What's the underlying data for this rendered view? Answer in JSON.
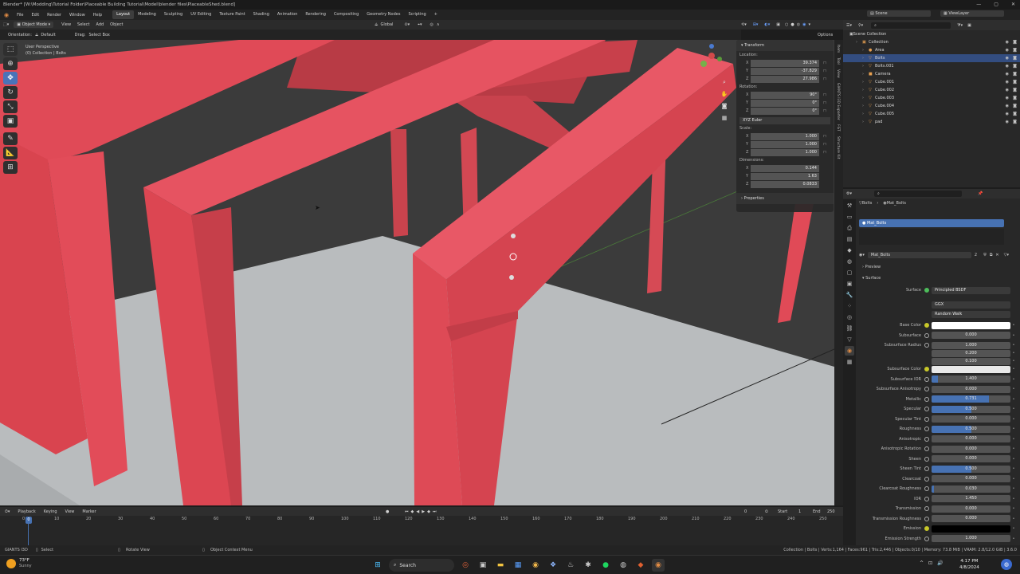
{
  "titlebar": {
    "title": "Blender* [W:\\Modding\\Tutorial Folder\\Placeable Building Tutorial\\Model\\blender files\\PlaceableShed.blend]",
    "minimize": "—",
    "maximize": "▢",
    "close": "✕"
  },
  "menu": {
    "items": [
      "File",
      "Edit",
      "Render",
      "Window",
      "Help"
    ]
  },
  "workspaces": [
    "Layout",
    "Modeling",
    "Sculpting",
    "UV Editing",
    "Texture Paint",
    "Shading",
    "Animation",
    "Rendering",
    "Compositing",
    "Geometry Nodes",
    "Scripting",
    "+"
  ],
  "scene": {
    "scene_label": "Scene",
    "viewlayer_label": "ViewLayer"
  },
  "viewport_header": {
    "mode": "Object Mode",
    "menus": [
      "View",
      "Select",
      "Add",
      "Object"
    ],
    "orientation_label": "Orientation:",
    "orientation": "Default",
    "drag_label": "Drag:",
    "drag": "Select Box",
    "transform": "Global",
    "options": "Options"
  },
  "viewport": {
    "perspective": "User Perspective",
    "collection": "(0) Collection | Bolts"
  },
  "npanel": {
    "transform_title": "Transform",
    "location_label": "Location:",
    "location": [
      {
        "axis": "X",
        "value": "39.374"
      },
      {
        "axis": "Y",
        "value": "-37.829"
      },
      {
        "axis": "Z",
        "value": "27.986"
      }
    ],
    "rotation_label": "Rotation:",
    "rotation": [
      {
        "axis": "X",
        "value": "90°"
      },
      {
        "axis": "Y",
        "value": "0°"
      },
      {
        "axis": "Z",
        "value": "0°"
      }
    ],
    "rotation_mode": "XYZ Euler",
    "scale_label": "Scale:",
    "scale": [
      {
        "axis": "X",
        "value": "1.000"
      },
      {
        "axis": "Y",
        "value": "1.000"
      },
      {
        "axis": "Z",
        "value": "1.000"
      }
    ],
    "dimensions_label": "Dimensions:",
    "dimensions": [
      {
        "axis": "X",
        "value": "0.144"
      },
      {
        "axis": "Y",
        "value": "1.63"
      },
      {
        "axis": "Z",
        "value": "0.0833"
      }
    ],
    "properties_title": "Properties",
    "tabs": [
      "Item",
      "Tool",
      "View",
      "GIANTS I3D Exporter",
      "FGT",
      "Structure Kit"
    ]
  },
  "outliner": {
    "root": "Scene Collection",
    "rows": [
      {
        "name": "Collection",
        "indent": 1,
        "icon": "▣"
      },
      {
        "name": "Area",
        "indent": 2,
        "icon": "●"
      },
      {
        "name": "Bolts",
        "indent": 2,
        "icon": "▽",
        "selected": true
      },
      {
        "name": "Bolts.001",
        "indent": 2,
        "icon": "▽"
      },
      {
        "name": "Camera",
        "indent": 2,
        "icon": "■"
      },
      {
        "name": "Cube.001",
        "indent": 2,
        "icon": "▽"
      },
      {
        "name": "Cube.002",
        "indent": 2,
        "icon": "▽"
      },
      {
        "name": "Cube.003",
        "indent": 2,
        "icon": "▽"
      },
      {
        "name": "Cube.004",
        "indent": 2,
        "icon": "▽"
      },
      {
        "name": "Cube.005",
        "indent": 2,
        "icon": "▽"
      },
      {
        "name": "pad",
        "indent": 2,
        "icon": "▽"
      }
    ]
  },
  "properties": {
    "breadcrumb": [
      "Bolts",
      "Mat_Bolts"
    ],
    "slot": "Mat_Bolts",
    "material_name": "Mat_Bolts",
    "material_users": "2",
    "preview_label": "Preview",
    "surface_label": "Surface",
    "surface_shader": "Principled BSDF",
    "distribution": "GGX",
    "subsurface_method": "Random Walk",
    "fields": [
      {
        "label": "Base Color",
        "type": "color",
        "color": "#ffffff"
      },
      {
        "label": "Subsurface",
        "value": "0.000",
        "fill": 0
      },
      {
        "label": "Subsurface Radius",
        "value": "1.000",
        "fill": 0
      },
      {
        "label": "",
        "value": "0.200",
        "fill": 0
      },
      {
        "label": "",
        "value": "0.100",
        "fill": 0
      },
      {
        "label": "Subsurface Color",
        "type": "color",
        "color": "#e8e8e8"
      },
      {
        "label": "Subsurface IOR",
        "value": "1.400",
        "fill": 0.08
      },
      {
        "label": "Subsurface Anisotropy",
        "value": "0.000",
        "fill": 0
      },
      {
        "label": "Metallic",
        "value": "0.731",
        "fill": 0.731
      },
      {
        "label": "Specular",
        "value": "0.500",
        "fill": 0.5
      },
      {
        "label": "Specular Tint",
        "value": "0.000",
        "fill": 0
      },
      {
        "label": "Roughness",
        "value": "0.500",
        "fill": 0.5
      },
      {
        "label": "Anisotropic",
        "value": "0.000",
        "fill": 0
      },
      {
        "label": "Anisotropic Rotation",
        "value": "0.000",
        "fill": 0
      },
      {
        "label": "Sheen",
        "value": "0.000",
        "fill": 0
      },
      {
        "label": "Sheen Tint",
        "value": "0.500",
        "fill": 0.5
      },
      {
        "label": "Clearcoat",
        "value": "0.000",
        "fill": 0
      },
      {
        "label": "Clearcoat Roughness",
        "value": "0.030",
        "fill": 0.03
      },
      {
        "label": "IOR",
        "value": "1.450",
        "fill": 0
      },
      {
        "label": "Transmission",
        "value": "0.000",
        "fill": 0
      },
      {
        "label": "Transmission Roughness",
        "value": "0.000",
        "fill": 0
      },
      {
        "label": "Emission",
        "type": "color",
        "color": "#000000"
      },
      {
        "label": "Emission Strength",
        "value": "1.000",
        "fill": 0
      }
    ]
  },
  "timeline": {
    "menus": [
      "Playback",
      "Keying",
      "View",
      "Marker"
    ],
    "current_frame": "0",
    "start_label": "Start",
    "start": "1",
    "end_label": "End",
    "end": "250",
    "ticks": [
      "0",
      "10",
      "20",
      "30",
      "40",
      "50",
      "60",
      "70",
      "80",
      "90",
      "100",
      "110",
      "120",
      "130",
      "140",
      "150",
      "160",
      "170",
      "180",
      "190",
      "200",
      "210",
      "220",
      "230",
      "240",
      "250"
    ],
    "playhead": "0"
  },
  "statusbar": {
    "left": "GIANTS I3D",
    "select": "Select",
    "rotate": "Rotate View",
    "context": "Object Context Menu",
    "stats": "Collection | Bolts | Verts:1,164 | Faces:961 | Tris:2,446 | Objects:0/10 | Memory: 73.8 MiB | VRAM: 2.8/12.0 GiB | 3.6.0"
  },
  "taskbar": {
    "weather_temp": "73°F",
    "weather_desc": "Sunny",
    "search": "Search",
    "time": "4:17 PM",
    "date": "4/8/2024"
  },
  "colors": {
    "accent": "#4772b3",
    "mesh_red": "#e04a57",
    "floor": "#b9bcbe",
    "active_tool": "#4a73b8"
  }
}
